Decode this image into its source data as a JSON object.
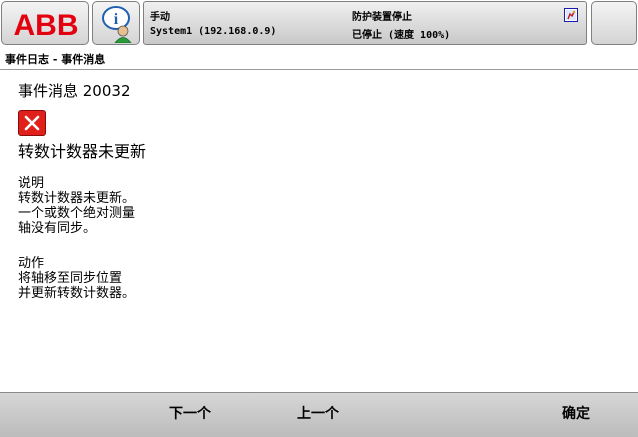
{
  "logo": {
    "text": "ABB"
  },
  "status": {
    "mode": "手动",
    "system": "System1 (192.168.0.9)",
    "guard": "防护装置停止",
    "state": "已停止 (速度 100%)"
  },
  "breadcrumb": "事件日志 - 事件消息",
  "message": {
    "header": "事件消息 20032",
    "title": "转数计数器未更新",
    "description_heading": "说明",
    "description_lines": [
      "转数计数器未更新。",
      "一个或数个绝对测量",
      "轴没有同步。"
    ],
    "action_heading": "动作",
    "action_lines": [
      "将轴移至同步位置",
      "并更新转数计数器。"
    ]
  },
  "buttons": {
    "next": "下一个",
    "previous": "上一个",
    "ok": "确定"
  },
  "colors": {
    "brand_red": "#e3000f",
    "error_red": "#e0201a",
    "bar_gray": "#c8c8c8"
  },
  "icons": {
    "info": "info-user-icon",
    "error": "error-x-icon",
    "warning": "robot-warning-icon"
  }
}
